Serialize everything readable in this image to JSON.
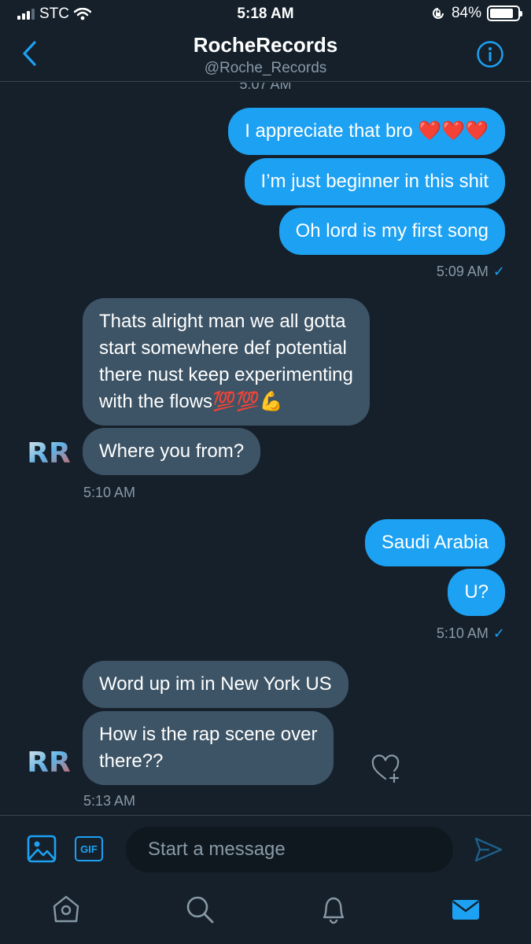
{
  "status_bar": {
    "carrier": "STC",
    "time": "5:18 AM",
    "battery": "84%",
    "battery_level": 0.84
  },
  "header": {
    "title": "RocheRecords",
    "handle": "@Roche_Records"
  },
  "conversation": {
    "cut_timestamp": "5:07 AM",
    "outgoing_1": [
      "I appreciate that bro ❤️❤️❤️",
      "I’m just beginner in this shit",
      "Oh lord is my first song"
    ],
    "ts_1": "5:09 AM",
    "incoming_1": [
      "Thats alright man we all gotta",
      "start somewhere def potential",
      "there nust keep experimenting",
      "with the flows💯💯💪",
      "Where you from?"
    ],
    "ts_2": "5:10 AM",
    "outgoing_2": [
      "Saudi Arabia",
      "U?"
    ],
    "ts_3": "5:10 AM",
    "incoming_2": [
      "Word up im in New York US",
      "How is the rap scene over",
      "there??"
    ],
    "ts_4": "5:13 AM",
    "avatar_text": "RR"
  },
  "composer": {
    "placeholder": "Start a message",
    "gif_label": "GIF"
  },
  "nav": {
    "items": [
      "home-icon",
      "search-icon",
      "notifications-icon",
      "messages-icon"
    ]
  },
  "colors": {
    "background": "#15202b",
    "outgoing_bubble": "#1da1f2",
    "incoming_bubble": "#3d5466",
    "accent": "#1da1f2",
    "muted": "#8899a6"
  }
}
